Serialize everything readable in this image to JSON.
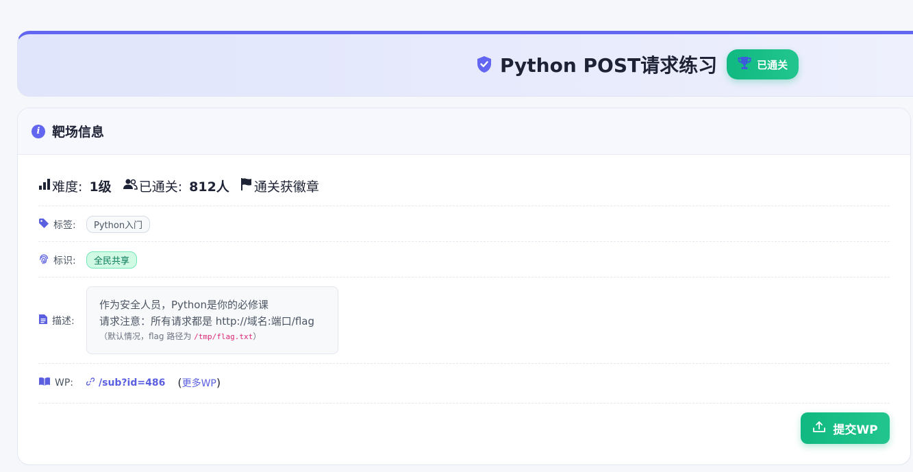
{
  "hero": {
    "title": "Python POST请求练习",
    "status_badge": "已通关"
  },
  "card": {
    "title": "靶场信息",
    "stats": {
      "difficulty_label": "难度:",
      "difficulty_value": "1级",
      "passed_label": "已通关:",
      "passed_value": "812人",
      "reward": "通关获徽章"
    },
    "tags_label": "标签:",
    "tags": [
      "Python入门"
    ],
    "ident_label": "标识:",
    "ident": "全民共享",
    "desc_label": "描述:",
    "desc_line1": "作为安全人员，Python是你的必修课",
    "desc_line2": "请求注意：所有请求都是 http://域名:端口/flag",
    "desc_note_prefix": "（默认情况，flag 路径为 ",
    "desc_note_path": "/tmp/flag.txt",
    "desc_note_suffix": "）",
    "wp_label": "WP:",
    "wp_link": "/sub?id=486",
    "more_wp_open": "(",
    "more_wp": "更多WP",
    "more_wp_close": ")",
    "submit_button": "提交WP"
  },
  "colors": {
    "accent": "#6366f1",
    "success": "#10b981"
  }
}
